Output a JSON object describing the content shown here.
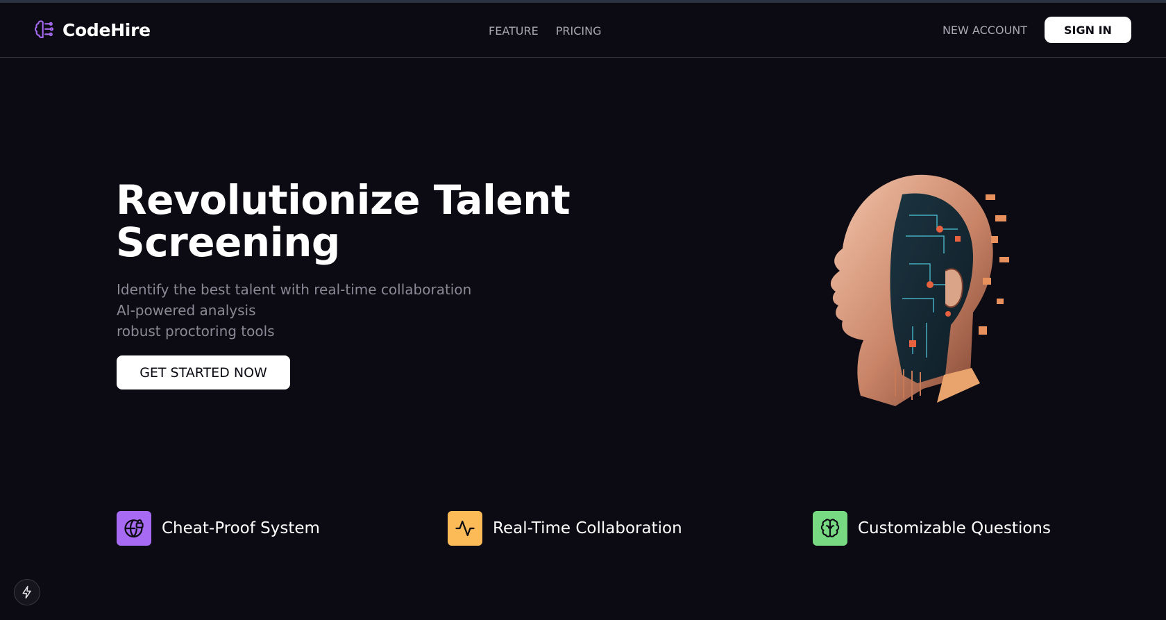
{
  "brand": {
    "name": "CodeHire",
    "icon": "brain-icon",
    "accent": "#a66bf2"
  },
  "nav": {
    "links": [
      "FEATURE",
      "PRICING"
    ],
    "new_account": "NEW ACCOUNT",
    "sign_in": "SIGN IN"
  },
  "hero": {
    "title_line1": "Revolutionize Talent",
    "title_line2": "Screening",
    "subtitle_lines": [
      "Identify the best talent with real-time collaboration",
      "AI-powered analysis",
      "robust proctoring tools"
    ],
    "cta": "GET STARTED NOW",
    "image": "robotic-head-illustration"
  },
  "features": [
    {
      "label": "Cheat-Proof System",
      "icon": "globe-lock-icon",
      "color": "#a66bf2"
    },
    {
      "label": "Real-Time Collaboration",
      "icon": "activity-icon",
      "color": "#fdbb58"
    },
    {
      "label": "Customizable Questions",
      "icon": "brain-icon",
      "color": "#77d982"
    }
  ],
  "floating_button": {
    "icon": "lightning-icon"
  },
  "colors": {
    "background": "#0c0b13",
    "muted_text": "#8b8996",
    "nav_text": "#a9a7b3"
  }
}
